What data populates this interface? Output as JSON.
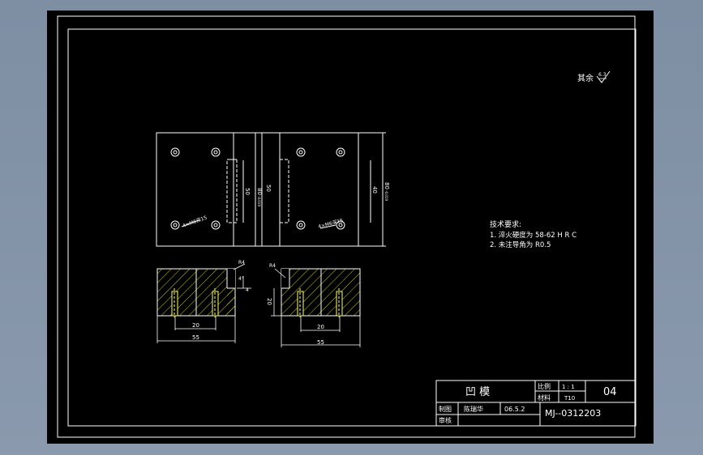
{
  "viewport": {
    "title": ""
  },
  "surface_note": {
    "label": "其余",
    "roughness": "6.3"
  },
  "tech_requirements": {
    "title": "技术要求:",
    "items": [
      "1. 淬火硬度为 58-62 H R C",
      "2. 未注导角为 R0.5"
    ]
  },
  "plan_views": {
    "left": {
      "thread_note": "4×M6深15",
      "dim_inner": "50",
      "dim_outer": "80",
      "tol": "-0.019"
    },
    "right": {
      "thread_note": "4×M6深15",
      "dim_inner": "50",
      "dim_outer": "80",
      "dim_side": "40",
      "tol": "-0.019"
    }
  },
  "section_views": {
    "left": {
      "chamfer": "R4",
      "angle": "4°",
      "dim_depth": "4",
      "dim_inner": "20",
      "dim_outer": "55"
    },
    "right": {
      "chamfer": "R4",
      "dim_height": "20",
      "dim_inner": "20",
      "dim_outer": "55"
    }
  },
  "title_block": {
    "part_name": "凹  模",
    "scale_label": "比例",
    "scale_value": "1 : 1",
    "material_label": "材料",
    "material_value": "T10",
    "sheet_no": "04",
    "drawn_label": "制图",
    "drawn_by": "陈瑞华",
    "date": "06.5.2",
    "checked_label": "审核",
    "drawing_no": "MJ--0312203"
  },
  "colors": {
    "line": "#ffffff",
    "accent": "#ffff66",
    "hatch": "#ffff00",
    "background": "#000000"
  }
}
